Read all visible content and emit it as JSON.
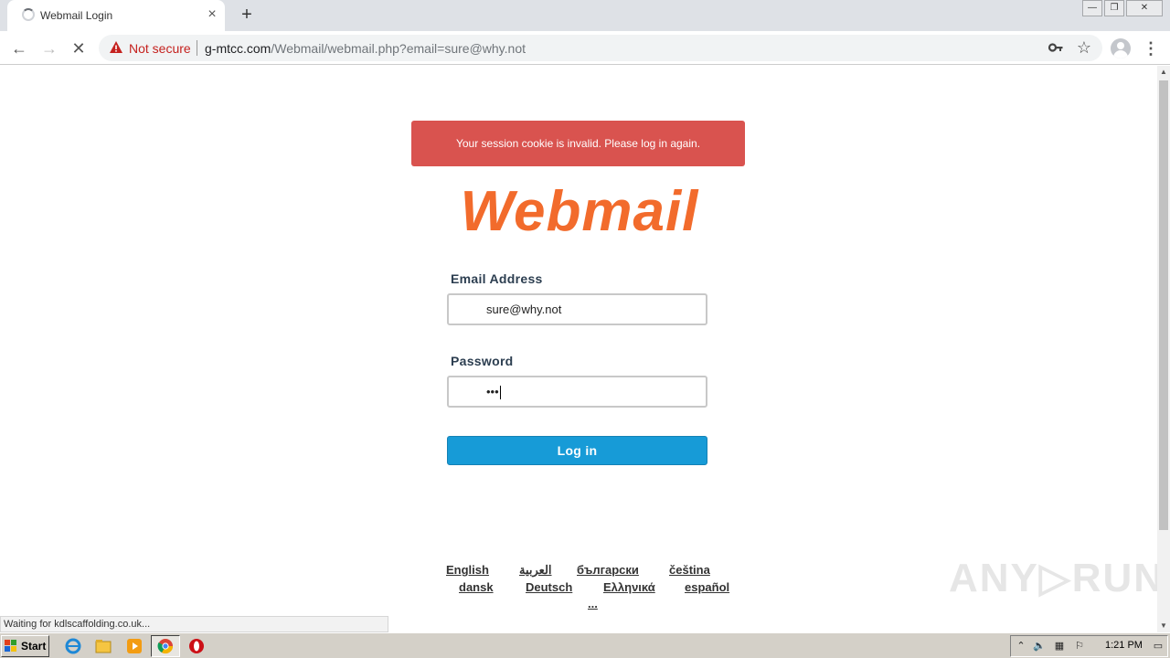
{
  "browser": {
    "tab_title": "Webmail Login",
    "tab_close": "×",
    "new_tab": "+",
    "window_controls": {
      "minimize": "—",
      "restore": "❐",
      "close": "✕"
    },
    "nav": {
      "back": "←",
      "forward": "→",
      "stop": "✕"
    },
    "security_label": "Not secure",
    "url_host": "g-mtcc.com",
    "url_path": "/Webmail/webmail.php?email=sure@why.not",
    "bookmark_icon": "☆",
    "menu_icon": "⋮"
  },
  "page": {
    "alert_text": "Your session cookie is invalid. Please log in again.",
    "logo_text": "Webmail",
    "brand_color": "#f26b2c",
    "email_label": "Email Address",
    "email_value": "sure@why.not",
    "password_label": "Password",
    "password_value": "•••",
    "login_button": "Log in",
    "languages": [
      "English",
      "العربية",
      "български",
      "čeština",
      "dansk",
      "Deutsch",
      "Ελληνικά",
      "español",
      "..."
    ]
  },
  "status_text": "Waiting for kdlscaffolding.co.uk...",
  "watermark": "ANY▷RUN",
  "taskbar": {
    "start_label": "Start",
    "clock": "1:21 PM"
  }
}
